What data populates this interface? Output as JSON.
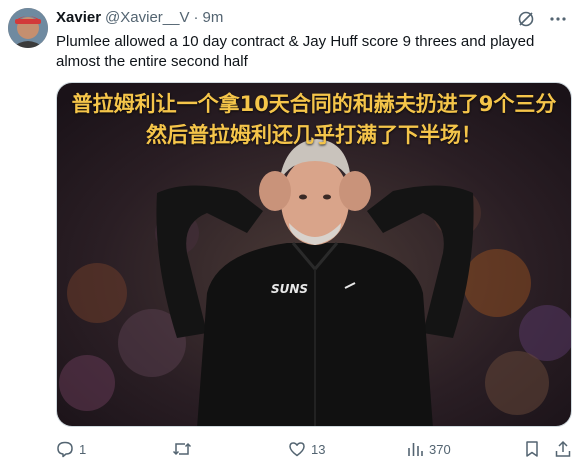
{
  "author": {
    "name": "Xavier",
    "handle": "@Xavier__V",
    "separator": "·",
    "time": "9m"
  },
  "tweet_text": "Plumlee allowed a 10 day contract & Jay Huff score 9 threes and played almost the entire second half",
  "media": {
    "caption_line1": "普拉姆利让一个拿10天合同的和赫夫扔进了9个三分",
    "caption_line2": "然后普拉姆利还几乎打满了下半场！",
    "jersey_text": "SUNS"
  },
  "actions": {
    "replies": "1",
    "retweets": "",
    "likes": "13",
    "views": "370"
  },
  "icons": [
    "grok-icon",
    "more-icon",
    "reply-icon",
    "retweet-icon",
    "like-icon",
    "views-icon",
    "bookmark-icon",
    "share-icon"
  ],
  "colors": {
    "caption": "#f5c54a",
    "muted": "#536471",
    "text": "#0f1419"
  }
}
